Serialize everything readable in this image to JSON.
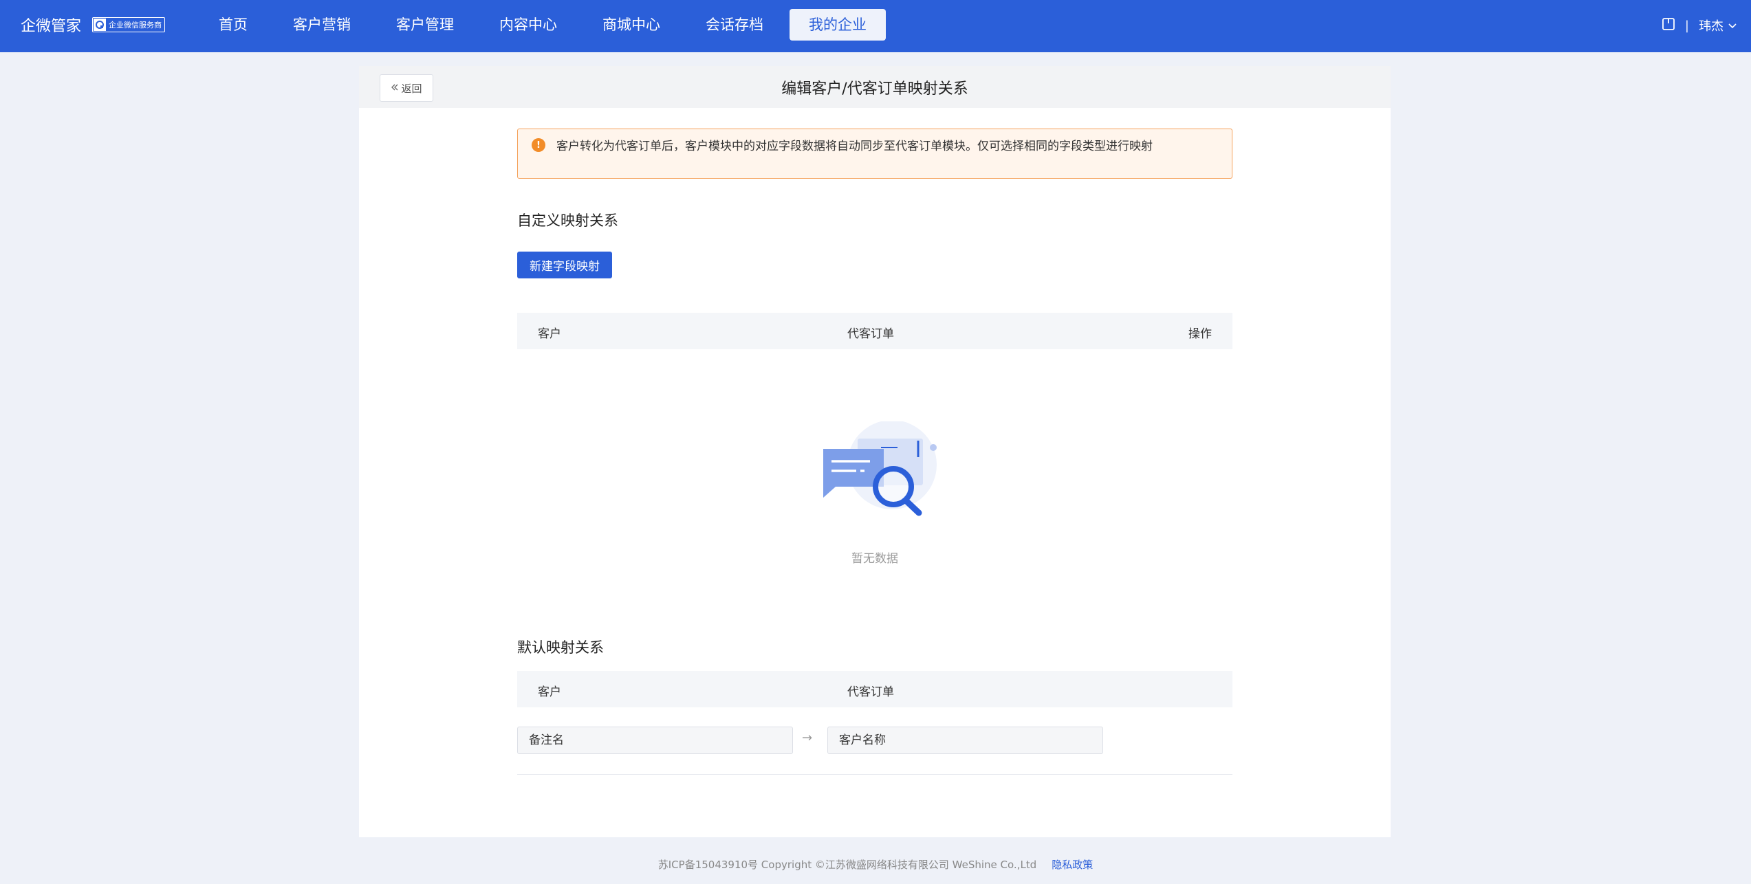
{
  "brand": {
    "name": "企微管家",
    "badge": "企业微信服务商"
  },
  "nav": {
    "items": [
      {
        "label": "首页"
      },
      {
        "label": "客户营销"
      },
      {
        "label": "客户管理"
      },
      {
        "label": "内容中心"
      },
      {
        "label": "商城中心"
      },
      {
        "label": "会话存档"
      },
      {
        "label": "我的企业",
        "active": true
      }
    ]
  },
  "user": {
    "separator": "|",
    "name": "玮杰"
  },
  "page": {
    "back_label": "返回",
    "title": "编辑客户/代客订单映射关系",
    "notice": "客户转化为代客订单后，客户模块中的对应字段数据将自动同步至代客订单模块。仅可选择相同的字段类型进行映射"
  },
  "custom_section": {
    "title": "自定义映射关系",
    "new_button": "新建字段映射",
    "columns": [
      "客户",
      "代客订单",
      "操作"
    ],
    "empty_text": "暂无数据"
  },
  "default_section": {
    "title": "默认映射关系",
    "columns": [
      "客户",
      "代客订单"
    ],
    "rows": [
      {
        "customer_field": "备注名",
        "arrow": "→",
        "order_field": "客户名称"
      }
    ]
  },
  "footer": {
    "copyright": "苏ICP备15043910号 Copyright ©江苏微盛网络科技有限公司 WeShine Co.,Ltd",
    "privacy_link": "隐私政策"
  },
  "colors": {
    "primary": "#2b5fd9",
    "warning_border": "#f5a25b",
    "warning_bg": "#fff5ec"
  }
}
